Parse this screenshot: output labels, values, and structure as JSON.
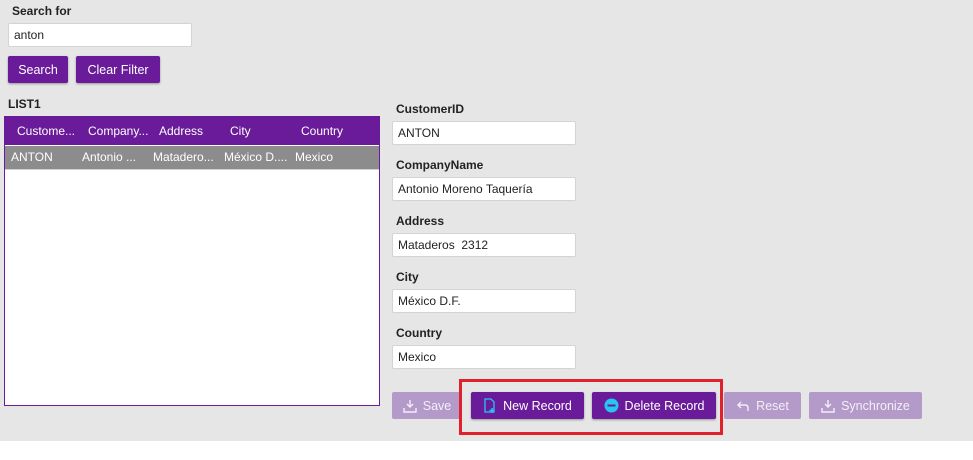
{
  "search": {
    "label": "Search for",
    "value": "anton",
    "search_button": "Search",
    "clear_button": "Clear Filter"
  },
  "list": {
    "title": "LIST1",
    "columns": [
      "Custome...",
      "Company...",
      "Address",
      "City",
      "Country"
    ],
    "rows": [
      [
        "ANTON",
        "Antonio ...",
        "Matadero...",
        "México D....",
        "Mexico"
      ]
    ]
  },
  "form": {
    "customer_id_label": "CustomerID",
    "customer_id_value": "ANTON",
    "company_name_label": "CompanyName",
    "company_name_value": "Antonio Moreno Taquería",
    "address_label": "Address",
    "address_value": "Mataderos  2312",
    "city_label": "City",
    "city_value": "México D.F.",
    "country_label": "Country",
    "country_value": "Mexico"
  },
  "toolbar": {
    "save": "Save",
    "new_record": "New Record",
    "delete_record": "Delete Record",
    "reset": "Reset",
    "synchronize": "Synchronize"
  },
  "colors": {
    "accent": "#6a1b9a",
    "accent_disabled": "#b49ac8",
    "selected_row": "#8c8c8c",
    "highlight_box": "#e0202a",
    "icon_cyan": "#26c6f0"
  }
}
